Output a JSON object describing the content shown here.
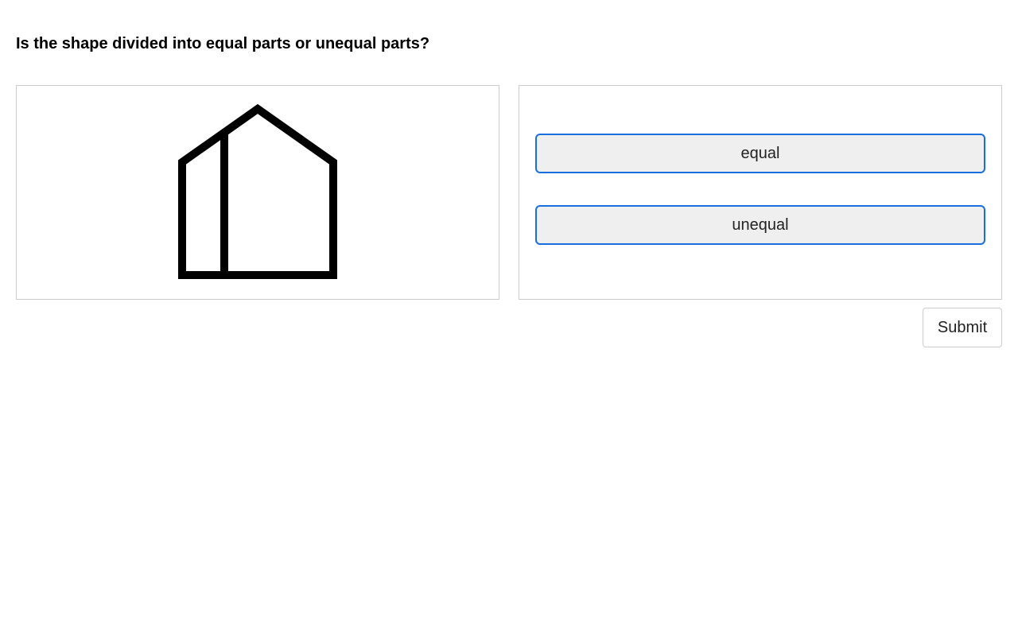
{
  "question": {
    "text": "Is the shape divided into equal parts or unequal parts?"
  },
  "figure": {
    "description_icon": "divided-pentagon-house-shape",
    "stroke_color": "#000000"
  },
  "choices": [
    {
      "label": "equal"
    },
    {
      "label": "unequal"
    }
  ],
  "submit": {
    "label": "Submit"
  },
  "colors": {
    "choice_border": "#1a6fdf",
    "choice_background": "#efefef",
    "panel_border": "#cccccc"
  }
}
